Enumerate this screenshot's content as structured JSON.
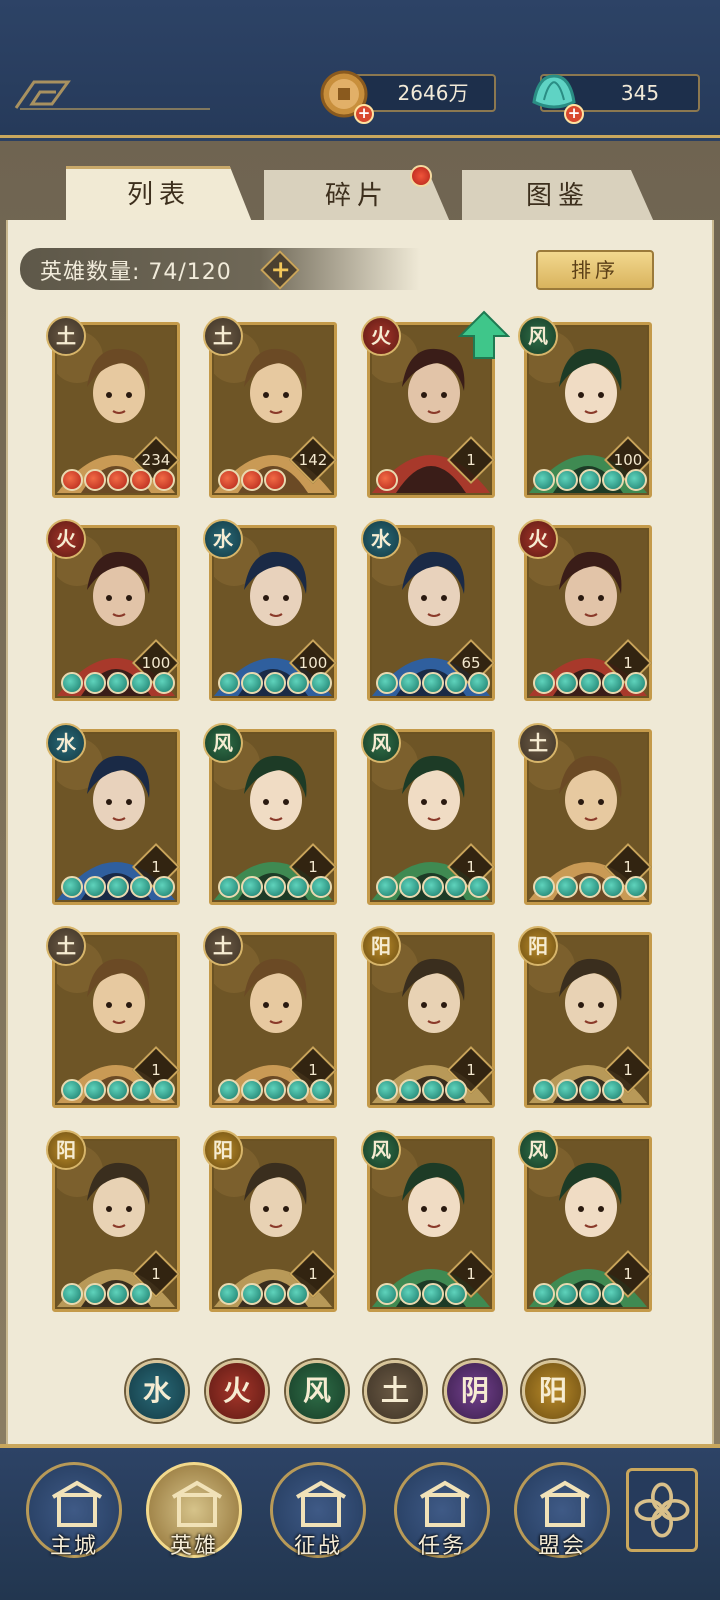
{
  "currency": {
    "gold_value": "2646万",
    "gem_value": "345",
    "plus_glyph": "+"
  },
  "tabs": [
    {
      "label": "列表",
      "active": true
    },
    {
      "label": "碎片",
      "has_alert": true
    },
    {
      "label": "图鉴"
    }
  ],
  "roster": {
    "count_label": "英雄数量: 74/120",
    "add_glyph": "+",
    "sort_label": "排序"
  },
  "elements": {
    "earth": "土",
    "fire": "火",
    "wind": "风",
    "water": "水",
    "yin": "阴",
    "yang": "阳"
  },
  "heroes": [
    {
      "element": "earth",
      "level": "234",
      "stars": 5,
      "star_color": "red"
    },
    {
      "element": "earth",
      "level": "142",
      "stars": 3,
      "star_color": "red"
    },
    {
      "element": "fire",
      "level": "1",
      "stars": 1,
      "star_color": "red",
      "upgradable": true
    },
    {
      "element": "wind",
      "level": "100",
      "stars": 5,
      "star_color": "teal"
    },
    {
      "element": "fire",
      "level": "100",
      "stars": 5,
      "star_color": "teal"
    },
    {
      "element": "water",
      "level": "100",
      "stars": 5,
      "star_color": "teal"
    },
    {
      "element": "water",
      "level": "65",
      "stars": 5,
      "star_color": "teal"
    },
    {
      "element": "fire",
      "level": "1",
      "stars": 5,
      "star_color": "teal"
    },
    {
      "element": "water",
      "level": "1",
      "stars": 5,
      "star_color": "teal"
    },
    {
      "element": "wind",
      "level": "1",
      "stars": 5,
      "star_color": "teal"
    },
    {
      "element": "wind",
      "level": "1",
      "stars": 5,
      "star_color": "teal"
    },
    {
      "element": "earth",
      "level": "1",
      "stars": 5,
      "star_color": "teal"
    },
    {
      "element": "earth",
      "level": "1",
      "stars": 5,
      "star_color": "teal"
    },
    {
      "element": "earth",
      "level": "1",
      "stars": 5,
      "star_color": "teal"
    },
    {
      "element": "yang",
      "level": "1",
      "stars": 4,
      "star_color": "teal"
    },
    {
      "element": "yang",
      "level": "1",
      "stars": 4,
      "star_color": "teal"
    },
    {
      "element": "yang",
      "level": "1",
      "stars": 4,
      "star_color": "teal"
    },
    {
      "element": "yang",
      "level": "1",
      "stars": 4,
      "star_color": "teal"
    },
    {
      "element": "wind",
      "level": "1",
      "stars": 4,
      "star_color": "teal"
    },
    {
      "element": "wind",
      "level": "1",
      "stars": 4,
      "star_color": "teal"
    }
  ],
  "filters": [
    "water",
    "fire",
    "wind",
    "earth",
    "yin",
    "yang"
  ],
  "nav": [
    {
      "label": "主城",
      "icon": "city-gate-icon"
    },
    {
      "label": "英雄",
      "icon": "hero-portrait-icon",
      "active": true
    },
    {
      "label": "征战",
      "icon": "battle-icon"
    },
    {
      "label": "任务",
      "icon": "task-icon"
    },
    {
      "label": "盟会",
      "icon": "alliance-icon"
    }
  ],
  "colors": {
    "navy": "#2b4062",
    "gold": "#c9a75d",
    "parchment": "#efe9d6",
    "star_red": "#d8442a",
    "star_teal": "#2aa08a"
  }
}
